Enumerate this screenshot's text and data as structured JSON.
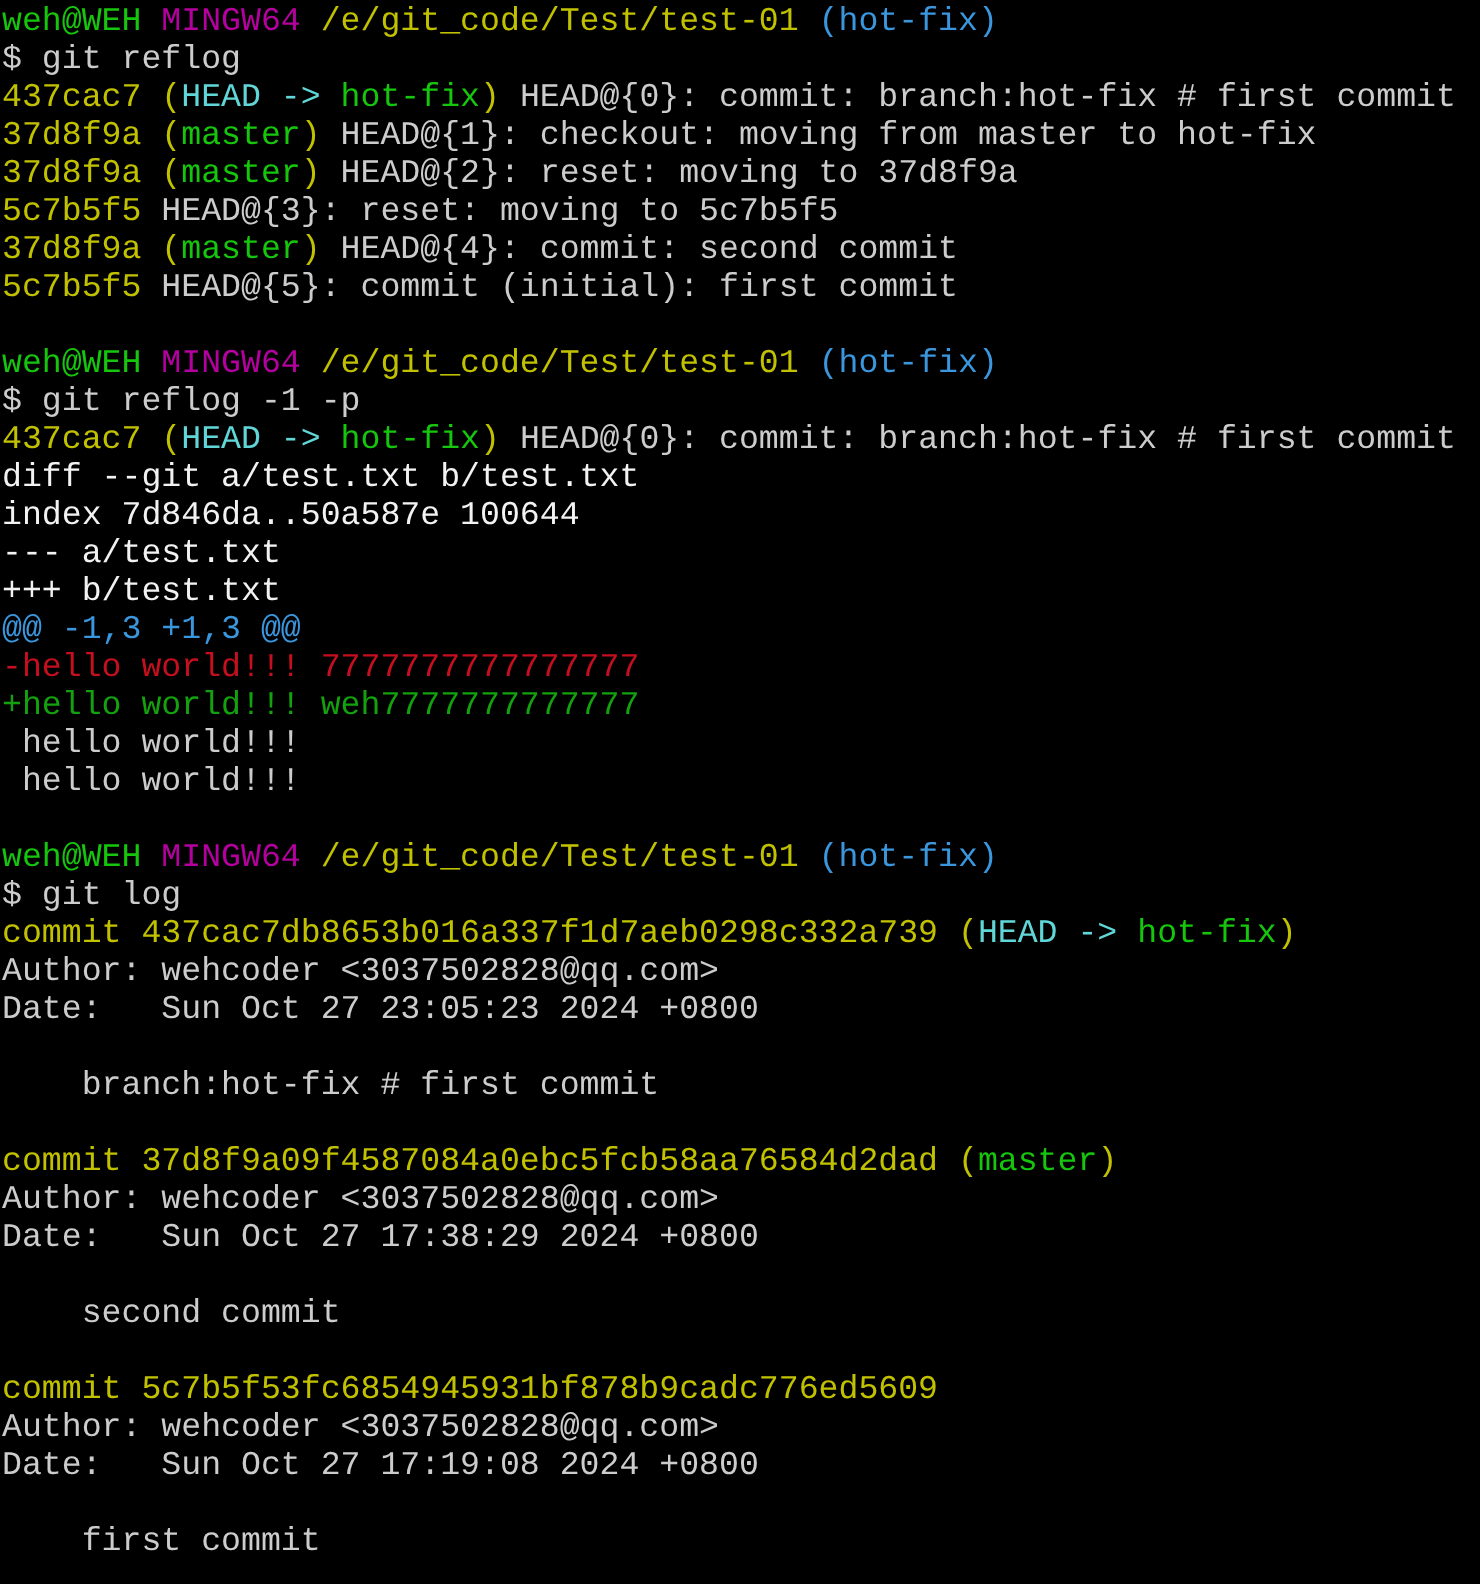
{
  "sessions": [
    {
      "prompt": {
        "user": "weh@WEH",
        "host": "MINGW64",
        "path": "/e/git_code/Test/test-01",
        "branch": "(hot-fix)"
      },
      "command": "$ git reflog",
      "output": [
        [
          {
            "kind": "hash",
            "text": "437cac7 ("
          },
          {
            "kind": "head",
            "text": "HEAD -> "
          },
          {
            "kind": "ref",
            "text": "hot-fix"
          },
          {
            "kind": "hash",
            "text": ")"
          },
          {
            "kind": "plain",
            "text": " HEAD@{0}: commit: branch:hot-fix # first commit"
          }
        ],
        [
          {
            "kind": "hash",
            "text": "37d8f9a ("
          },
          {
            "kind": "ref",
            "text": "master"
          },
          {
            "kind": "hash",
            "text": ")"
          },
          {
            "kind": "plain",
            "text": " HEAD@{1}: checkout: moving from master to hot-fix"
          }
        ],
        [
          {
            "kind": "hash",
            "text": "37d8f9a ("
          },
          {
            "kind": "ref",
            "text": "master"
          },
          {
            "kind": "hash",
            "text": ")"
          },
          {
            "kind": "plain",
            "text": " HEAD@{2}: reset: moving to 37d8f9a"
          }
        ],
        [
          {
            "kind": "hash",
            "text": "5c7b5f5"
          },
          {
            "kind": "plain",
            "text": " HEAD@{3}: reset: moving to 5c7b5f5"
          }
        ],
        [
          {
            "kind": "hash",
            "text": "37d8f9a ("
          },
          {
            "kind": "ref",
            "text": "master"
          },
          {
            "kind": "hash",
            "text": ")"
          },
          {
            "kind": "plain",
            "text": " HEAD@{4}: commit: second commit"
          }
        ],
        [
          {
            "kind": "hash",
            "text": "5c7b5f5"
          },
          {
            "kind": "plain",
            "text": " HEAD@{5}: commit (initial): first commit"
          }
        ]
      ]
    },
    {
      "prompt": {
        "user": "weh@WEH",
        "host": "MINGW64",
        "path": "/e/git_code/Test/test-01",
        "branch": "(hot-fix)"
      },
      "command": "$ git reflog -1 -p",
      "output": [
        [
          {
            "kind": "hash",
            "text": "437cac7 ("
          },
          {
            "kind": "head",
            "text": "HEAD -> "
          },
          {
            "kind": "ref",
            "text": "hot-fix"
          },
          {
            "kind": "hash",
            "text": ")"
          },
          {
            "kind": "plain",
            "text": " HEAD@{0}: commit: branch:hot-fix # first commit"
          }
        ],
        [
          {
            "kind": "meta",
            "text": "diff --git a/test.txt b/test.txt"
          }
        ],
        [
          {
            "kind": "meta",
            "text": "index 7d846da..50a587e 100644"
          }
        ],
        [
          {
            "kind": "meta",
            "text": "--- a/test.txt"
          }
        ],
        [
          {
            "kind": "meta",
            "text": "+++ b/test.txt"
          }
        ],
        [
          {
            "kind": "hunk",
            "text": "@@ -1,3 +1,3 @@"
          }
        ],
        [
          {
            "kind": "deleted",
            "text": "-hello world!!! 7777777777777777"
          }
        ],
        [
          {
            "kind": "added",
            "text": "+hello world!!! weh7777777777777"
          }
        ],
        [
          {
            "kind": "plain",
            "text": " hello world!!!"
          }
        ],
        [
          {
            "kind": "plain",
            "text": " hello world!!!"
          }
        ]
      ]
    },
    {
      "prompt": {
        "user": "weh@WEH",
        "host": "MINGW64",
        "path": "/e/git_code/Test/test-01",
        "branch": "(hot-fix)"
      },
      "command": "$ git log",
      "commits": [
        {
          "header": [
            {
              "kind": "hash",
              "text": "commit 437cac7db8653b016a337f1d7aeb0298c332a739 ("
            },
            {
              "kind": "head",
              "text": "HEAD -> "
            },
            {
              "kind": "ref",
              "text": "hot-fix"
            },
            {
              "kind": "hash",
              "text": ")"
            }
          ],
          "author": "Author: wehcoder <3037502828@qq.com>",
          "date": "Date:   Sun Oct 27 23:05:23 2024 +0800",
          "message": "branch:hot-fix # first commit"
        },
        {
          "header": [
            {
              "kind": "hash",
              "text": "commit 37d8f9a09f4587084a0ebc5fcb58aa76584d2dad ("
            },
            {
              "kind": "ref",
              "text": "master"
            },
            {
              "kind": "hash",
              "text": ")"
            }
          ],
          "author": "Author: wehcoder <3037502828@qq.com>",
          "date": "Date:   Sun Oct 27 17:38:29 2024 +0800",
          "message": "second commit"
        },
        {
          "header": [
            {
              "kind": "hash",
              "text": "commit 5c7b5f53fc6854945931bf878b9cadc776ed5609"
            }
          ],
          "author": "Author: wehcoder <3037502828@qq.com>",
          "date": "Date:   Sun Oct 27 17:19:08 2024 +0800",
          "message": "first commit"
        }
      ]
    }
  ]
}
